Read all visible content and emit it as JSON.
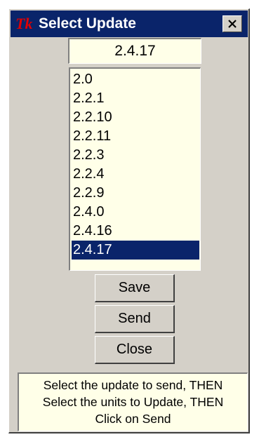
{
  "window": {
    "title": "Select Update",
    "logo_text": "Tk",
    "close_icon": "close-x-icon"
  },
  "entry": {
    "value": "2.4.17"
  },
  "updates": {
    "items": [
      "2.0",
      "2.2.1",
      "2.2.10",
      "2.2.11",
      "2.2.3",
      "2.2.4",
      "2.2.9",
      "2.4.0",
      "2.4.16",
      "2.4.17"
    ],
    "selected": "2.4.17"
  },
  "buttons": {
    "save": "Save",
    "send": "Send",
    "close": "Close"
  },
  "instructions": {
    "line1": "Select the update to send, THEN",
    "line2": "Select the units to Update, THEN",
    "line3": "Click on Send"
  },
  "colors": {
    "title_bar": "#0a246a",
    "selection": "#0a246a",
    "field_bg": "#ffffe8",
    "window_bg": "#d4d0c8",
    "logo_red": "#e00000"
  }
}
